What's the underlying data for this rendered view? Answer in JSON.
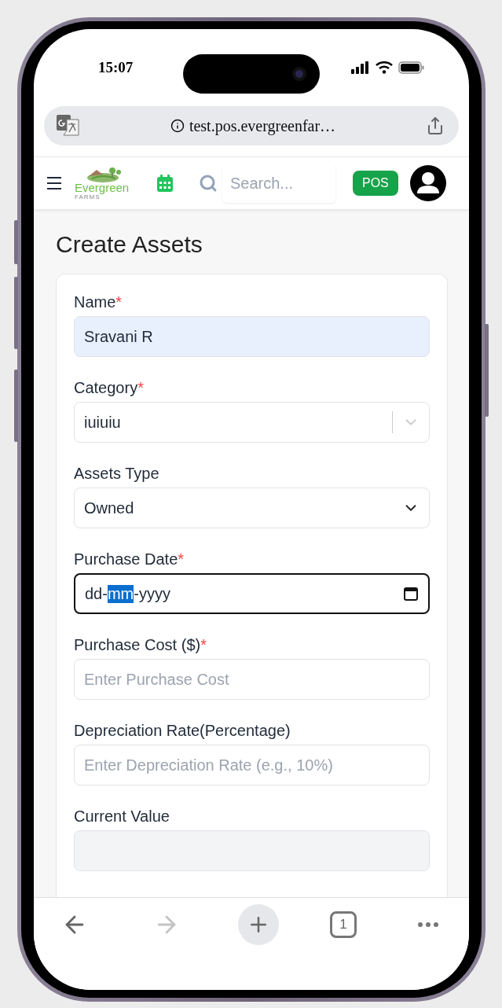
{
  "status_bar": {
    "time": "15:07"
  },
  "address_bar": {
    "url": "test.pos.evergreenfar…"
  },
  "header": {
    "logo": {
      "name": "Evergreen",
      "tagline": "FARMS"
    },
    "search": {
      "placeholder": "Search..."
    },
    "pos_button": "POS"
  },
  "page": {
    "title": "Create Assets"
  },
  "form": {
    "required_mark": "*",
    "fields": [
      {
        "kind": "text",
        "label": "Name",
        "required": true,
        "value": "Sravani R",
        "autofilled": true
      },
      {
        "kind": "select",
        "label": "Category",
        "required": true,
        "value": "iuiuiu"
      },
      {
        "kind": "dropdown",
        "label": "Assets Type",
        "required": false,
        "value": "Owned"
      },
      {
        "kind": "date",
        "label": "Purchase Date",
        "required": true,
        "focused": true,
        "separator": "-",
        "segments": [
          {
            "text": "dd",
            "selected": false
          },
          {
            "text": "mm",
            "selected": true
          },
          {
            "text": "yyyy",
            "selected": false
          }
        ]
      },
      {
        "kind": "text",
        "label": "Purchase Cost ($)",
        "required": true,
        "placeholder": "Enter Purchase Cost"
      },
      {
        "kind": "text",
        "label": "Depreciation Rate(Percentage)",
        "required": false,
        "placeholder": "Enter Depreciation Rate (e.g., 10%)"
      },
      {
        "kind": "text",
        "label": "Current Value",
        "required": false,
        "disabled": true
      }
    ]
  },
  "toolbar": {
    "forward_disabled": true,
    "tab_count": "1"
  }
}
